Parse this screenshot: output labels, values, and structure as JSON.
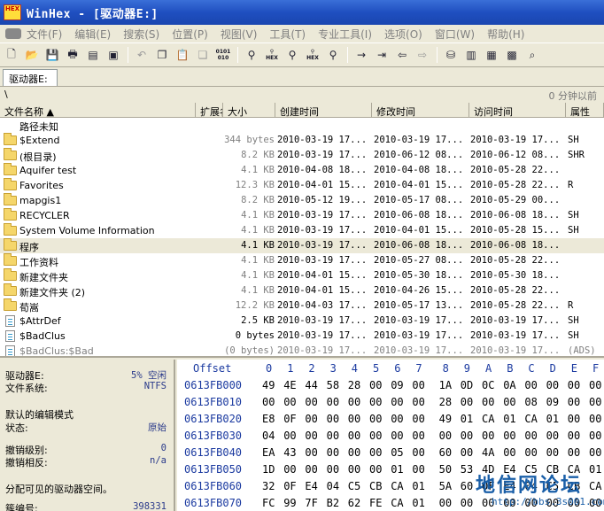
{
  "window": {
    "title": "WinHex - [驱动器E:]",
    "logo": "HEX"
  },
  "menu": [
    "文件(F)",
    "编辑(E)",
    "搜索(S)",
    "位置(P)",
    "视图(V)",
    "工具(T)",
    "专业工具(I)",
    "选项(O)",
    "窗口(W)",
    "帮助(H)"
  ],
  "tab": {
    "label": "驱动器E:"
  },
  "pathbar": {
    "path": "\\",
    "ago": "0 分钟以前"
  },
  "columns": [
    "文件名称 ▲",
    "扩展名",
    "大小",
    "创建时间",
    "修改时间",
    "访问时间",
    "属性"
  ],
  "files": [
    {
      "icon": "none",
      "name": "路径未知",
      "size": "",
      "created": "",
      "modified": "",
      "accessed": "",
      "attr": ""
    },
    {
      "icon": "folder",
      "name": "$Extend",
      "size": "344 bytes",
      "created": "2010-03-19  17...",
      "modified": "2010-03-19  17...",
      "accessed": "2010-03-19  17...",
      "attr": "SH"
    },
    {
      "icon": "folder",
      "name": "(根目录)",
      "size": "8.2 KB",
      "created": "2010-03-19  17...",
      "modified": "2010-06-12  08...",
      "accessed": "2010-06-12  08...",
      "attr": "SHR"
    },
    {
      "icon": "folder",
      "name": "Aquifer test",
      "size": "4.1 KB",
      "created": "2010-04-08  18...",
      "modified": "2010-04-08  18...",
      "accessed": "2010-05-28  22...",
      "attr": ""
    },
    {
      "icon": "folder",
      "name": "Favorites",
      "size": "12.3 KB",
      "created": "2010-04-01  15...",
      "modified": "2010-04-01  15...",
      "accessed": "2010-05-28  22...",
      "attr": "R"
    },
    {
      "icon": "folder",
      "name": "mapgis1",
      "size": "8.2 KB",
      "created": "2010-05-12  19...",
      "modified": "2010-05-17  08...",
      "accessed": "2010-05-29  00...",
      "attr": ""
    },
    {
      "icon": "folder",
      "name": "RECYCLER",
      "size": "4.1 KB",
      "created": "2010-03-19  17...",
      "modified": "2010-06-08  18...",
      "accessed": "2010-06-08  18...",
      "attr": "SH"
    },
    {
      "icon": "folder",
      "name": "System Volume Information",
      "size": "4.1 KB",
      "created": "2010-03-19  17...",
      "modified": "2010-04-01  15...",
      "accessed": "2010-05-28  15...",
      "attr": "SH"
    },
    {
      "icon": "folder",
      "name": "程序",
      "size": "4.1 KB",
      "created": "2010-03-19  17...",
      "modified": "2010-06-08  18...",
      "accessed": "2010-06-08  18...",
      "attr": "",
      "selected": true
    },
    {
      "icon": "folder",
      "name": "工作资料",
      "size": "4.1 KB",
      "created": "2010-03-19  17...",
      "modified": "2010-05-27  08...",
      "accessed": "2010-05-28  22...",
      "attr": ""
    },
    {
      "icon": "folder",
      "name": "新建文件夹",
      "size": "4.1 KB",
      "created": "2010-04-01  15...",
      "modified": "2010-05-30  18...",
      "accessed": "2010-05-30  18...",
      "attr": ""
    },
    {
      "icon": "folder",
      "name": "新建文件夹 (2)",
      "size": "4.1 KB",
      "created": "2010-04-01  15...",
      "modified": "2010-04-26  15...",
      "accessed": "2010-05-28  22...",
      "attr": ""
    },
    {
      "icon": "folder",
      "name": "荀嵩",
      "size": "12.2 KB",
      "created": "2010-04-03  17...",
      "modified": "2010-05-17  13...",
      "accessed": "2010-05-28  22...",
      "attr": "R"
    },
    {
      "icon": "file",
      "name": "$AttrDef",
      "size": "2.5 KB",
      "created": "2010-03-19  17...",
      "modified": "2010-03-19  17...",
      "accessed": "2010-03-19  17...",
      "attr": "SH"
    },
    {
      "icon": "file",
      "name": "$BadClus",
      "size": "0 bytes",
      "created": "2010-03-19  17...",
      "modified": "2010-03-19  17...",
      "accessed": "2010-03-19  17...",
      "attr": "SH"
    },
    {
      "icon": "file",
      "name": "$BadClus:$Bad",
      "size": "(0 bytes)",
      "created": "2010-03-19  17...",
      "modified": "2010-03-19  17...",
      "accessed": "2010-03-19  17...",
      "attr": "(ADS)",
      "dim": true
    }
  ],
  "info": {
    "drive_label": "驱动器E:",
    "drive_value": "5% 空闲",
    "fs_label": "文件系统:",
    "fs_value": "NTFS",
    "mode_title": "默认的编辑模式",
    "state_label": "状态:",
    "state_value": "原始",
    "undo_label": "撤销级别:",
    "undo_value": "0",
    "undo_rel_label": "撤销相反:",
    "undo_rel_value": "n/a",
    "alloc_label": "分配可见的驱动器空间。",
    "cluster_label": "簇编号:",
    "cluster_value": "398331"
  },
  "hex": {
    "header_offset": "Offset",
    "header_cols": [
      "0",
      "1",
      "2",
      "3",
      "4",
      "5",
      "6",
      "7",
      "8",
      "9",
      "A",
      "B",
      "C",
      "D",
      "E",
      "F"
    ],
    "rows": [
      {
        "offset": "0613FB000",
        "bytes": [
          "49",
          "4E",
          "44",
          "58",
          "28",
          "00",
          "09",
          "00",
          "1A",
          "0D",
          "0C",
          "0A",
          "00",
          "00",
          "00",
          "00"
        ]
      },
      {
        "offset": "0613FB010",
        "bytes": [
          "00",
          "00",
          "00",
          "00",
          "00",
          "00",
          "00",
          "00",
          "28",
          "00",
          "00",
          "00",
          "08",
          "09",
          "00",
          "00"
        ]
      },
      {
        "offset": "0613FB020",
        "bytes": [
          "E8",
          "0F",
          "00",
          "00",
          "00",
          "00",
          "00",
          "00",
          "49",
          "01",
          "CA",
          "01",
          "CA",
          "01",
          "00",
          "00"
        ]
      },
      {
        "offset": "0613FB030",
        "bytes": [
          "04",
          "00",
          "00",
          "00",
          "00",
          "00",
          "00",
          "00",
          "00",
          "00",
          "00",
          "00",
          "00",
          "00",
          "00",
          "00"
        ]
      },
      {
        "offset": "0613FB040",
        "bytes": [
          "EA",
          "43",
          "00",
          "00",
          "00",
          "00",
          "05",
          "00",
          "60",
          "00",
          "4A",
          "00",
          "00",
          "00",
          "00",
          "00"
        ]
      },
      {
        "offset": "0613FB050",
        "bytes": [
          "1D",
          "00",
          "00",
          "00",
          "00",
          "00",
          "01",
          "00",
          "50",
          "53",
          "4D",
          "E4",
          "C5",
          "CB",
          "CA",
          "01"
        ]
      },
      {
        "offset": "0613FB060",
        "bytes": [
          "32",
          "0F",
          "E4",
          "04",
          "C5",
          "CB",
          "CA",
          "01",
          "5A",
          "60",
          "0F",
          "E4",
          "04",
          "C5",
          "CB",
          "CA"
        ]
      },
      {
        "offset": "0613FB070",
        "bytes": [
          "FC",
          "99",
          "7F",
          "B2",
          "62",
          "FE",
          "CA",
          "01",
          "00",
          "00",
          "00",
          "00",
          "00",
          "00",
          "00",
          "00"
        ]
      }
    ]
  },
  "watermark": {
    "text": "地信网论坛",
    "url": "http://bbs.3s001.com"
  }
}
